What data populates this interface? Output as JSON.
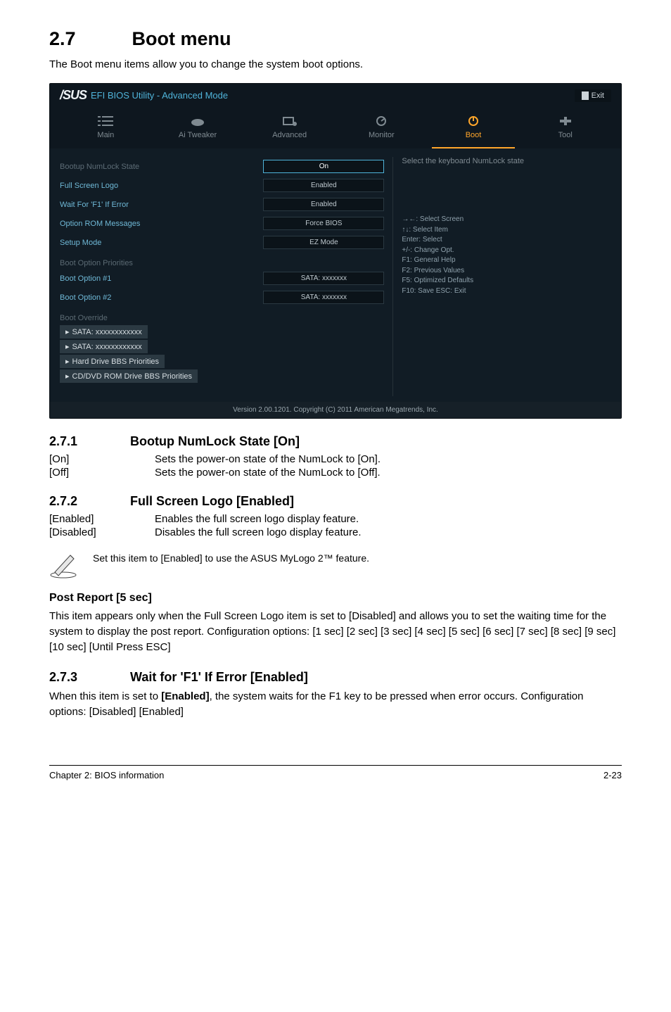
{
  "section": {
    "num": "2.7",
    "title": "Boot menu"
  },
  "intro": "The Boot menu items allow you to change the system boot options.",
  "bios": {
    "brand": "/SUS",
    "title": "EFI BIOS Utility - Advanced Mode",
    "exit": "Exit",
    "tabs": [
      "Main",
      "Ai Tweaker",
      "Advanced",
      "Monitor",
      "Boot",
      "Tool"
    ],
    "active_tab": "Boot",
    "options": [
      {
        "label": "Bootup NumLock State",
        "value": "On",
        "highlight": true
      },
      {
        "label": "Full Screen Logo",
        "value": "Enabled"
      },
      {
        "label": "Wait For 'F1' If Error",
        "value": "Enabled"
      },
      {
        "label": "Option ROM Messages",
        "value": "Force BIOS"
      },
      {
        "label": "Setup Mode",
        "value": "EZ Mode"
      }
    ],
    "boot_prio_head": "Boot Option Priorities",
    "boot_options": [
      {
        "label": "Boot Option #1",
        "value": "SATA: xxxxxxx"
      },
      {
        "label": "Boot Option #2",
        "value": "SATA: xxxxxxx"
      }
    ],
    "override_head": "Boot Override",
    "submenus": [
      "SATA: xxxxxxxxxxxx",
      "SATA: xxxxxxxxxxxx",
      "Hard Drive BBS Priorities",
      "CD/DVD ROM Drive BBS Priorities"
    ],
    "help_title": "Select the keyboard NumLock state",
    "help_keys": "→←: Select Screen\n↑↓: Select Item\nEnter: Select\n+/-: Change Opt.\nF1: General Help\nF2: Previous Values\nF5: Optimized Defaults\nF10: Save   ESC: Exit",
    "footer": "Version 2.00.1201.   Copyright (C) 2011 American Megatrends, Inc."
  },
  "s271": {
    "num": "2.7.1",
    "title": "Bootup NumLock State [On]",
    "rows": [
      {
        "k": "[On]",
        "v": "Sets the power-on state of the NumLock to [On]."
      },
      {
        "k": "[Off]",
        "v": "Sets the power-on state of the NumLock to [Off]."
      }
    ]
  },
  "s272": {
    "num": "2.7.2",
    "title": "Full Screen Logo [Enabled]",
    "rows": [
      {
        "k": "[Enabled]",
        "v": "Enables the full screen logo display feature."
      },
      {
        "k": "[Disabled]",
        "v": "Disables the full screen logo display feature."
      }
    ],
    "note": "Set this item to [Enabled] to use the ASUS MyLogo 2™ feature."
  },
  "postreport": {
    "title": "Post Report [5 sec]",
    "body": "This item appears only when the Full Screen Logo item is set to [Disabled] and allows you to set the waiting time for the system to display the post report. Configuration options: [1 sec] [2 sec] [3 sec] [4 sec] [5 sec] [6 sec] [7 sec] [8 sec] [9 sec] [10 sec] [Until Press ESC]"
  },
  "s273": {
    "num": "2.7.3",
    "title": "Wait for 'F1' If Error [Enabled]",
    "body1": "When this item is set to ",
    "bold": "[Enabled]",
    "body2": ", the system waits for the F1 key to be pressed when error occurs. Configuration options: [Disabled] [Enabled]"
  },
  "footer": {
    "left": "Chapter 2: BIOS information",
    "right": "2-23"
  }
}
